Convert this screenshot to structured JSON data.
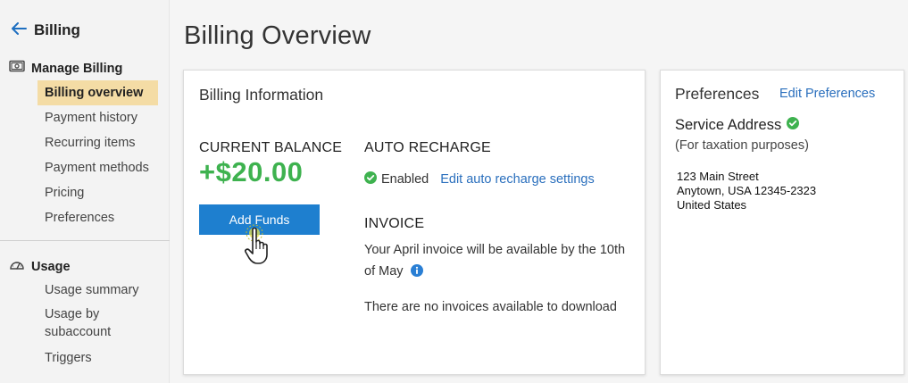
{
  "sidebar": {
    "back_label": "Billing",
    "manage_billing": {
      "title": "Manage Billing",
      "items": [
        {
          "label": "Billing overview",
          "active": true
        },
        {
          "label": "Payment history"
        },
        {
          "label": "Recurring items"
        },
        {
          "label": "Payment methods"
        },
        {
          "label": "Pricing"
        },
        {
          "label": "Preferences"
        }
      ]
    },
    "usage": {
      "title": "Usage",
      "items": [
        {
          "label": "Usage summary"
        },
        {
          "label": "Usage by subaccount"
        },
        {
          "label": "Triggers"
        }
      ]
    }
  },
  "page": {
    "title": "Billing Overview"
  },
  "billing_info": {
    "title": "Billing Information",
    "current_balance_label": "CURRENT BALANCE",
    "balance": "+$20.00",
    "add_funds_label": "Add Funds",
    "auto_recharge_label": "AUTO RECHARGE",
    "enabled_label": "Enabled",
    "edit_recharge_link": "Edit auto recharge settings",
    "invoice_label": "INVOICE",
    "invoice_line1": "Your April invoice will be available by the 10th",
    "invoice_line2": "of May",
    "no_invoices": "There are no invoices available to download"
  },
  "preferences": {
    "title": "Preferences",
    "edit_link": "Edit Preferences",
    "service_address_label": "Service Address",
    "taxation_note": "(For taxation purposes)",
    "address_lines": [
      "123 Main Street",
      "Anytown, USA 12345-2323",
      "United States"
    ]
  },
  "colors": {
    "accent": "#1e7fcf",
    "balance_green": "#3eb24f",
    "active_nav": "#f4dca5",
    "link": "#2a6fbd"
  },
  "icons": {
    "back": "arrow-left-icon",
    "manage_billing": "billing-money-icon",
    "usage": "gauge-icon",
    "enabled": "check-circle-icon",
    "invoice_info": "info-icon",
    "service_verified": "check-circle-icon",
    "cursor": "hand-pointer-icon"
  }
}
